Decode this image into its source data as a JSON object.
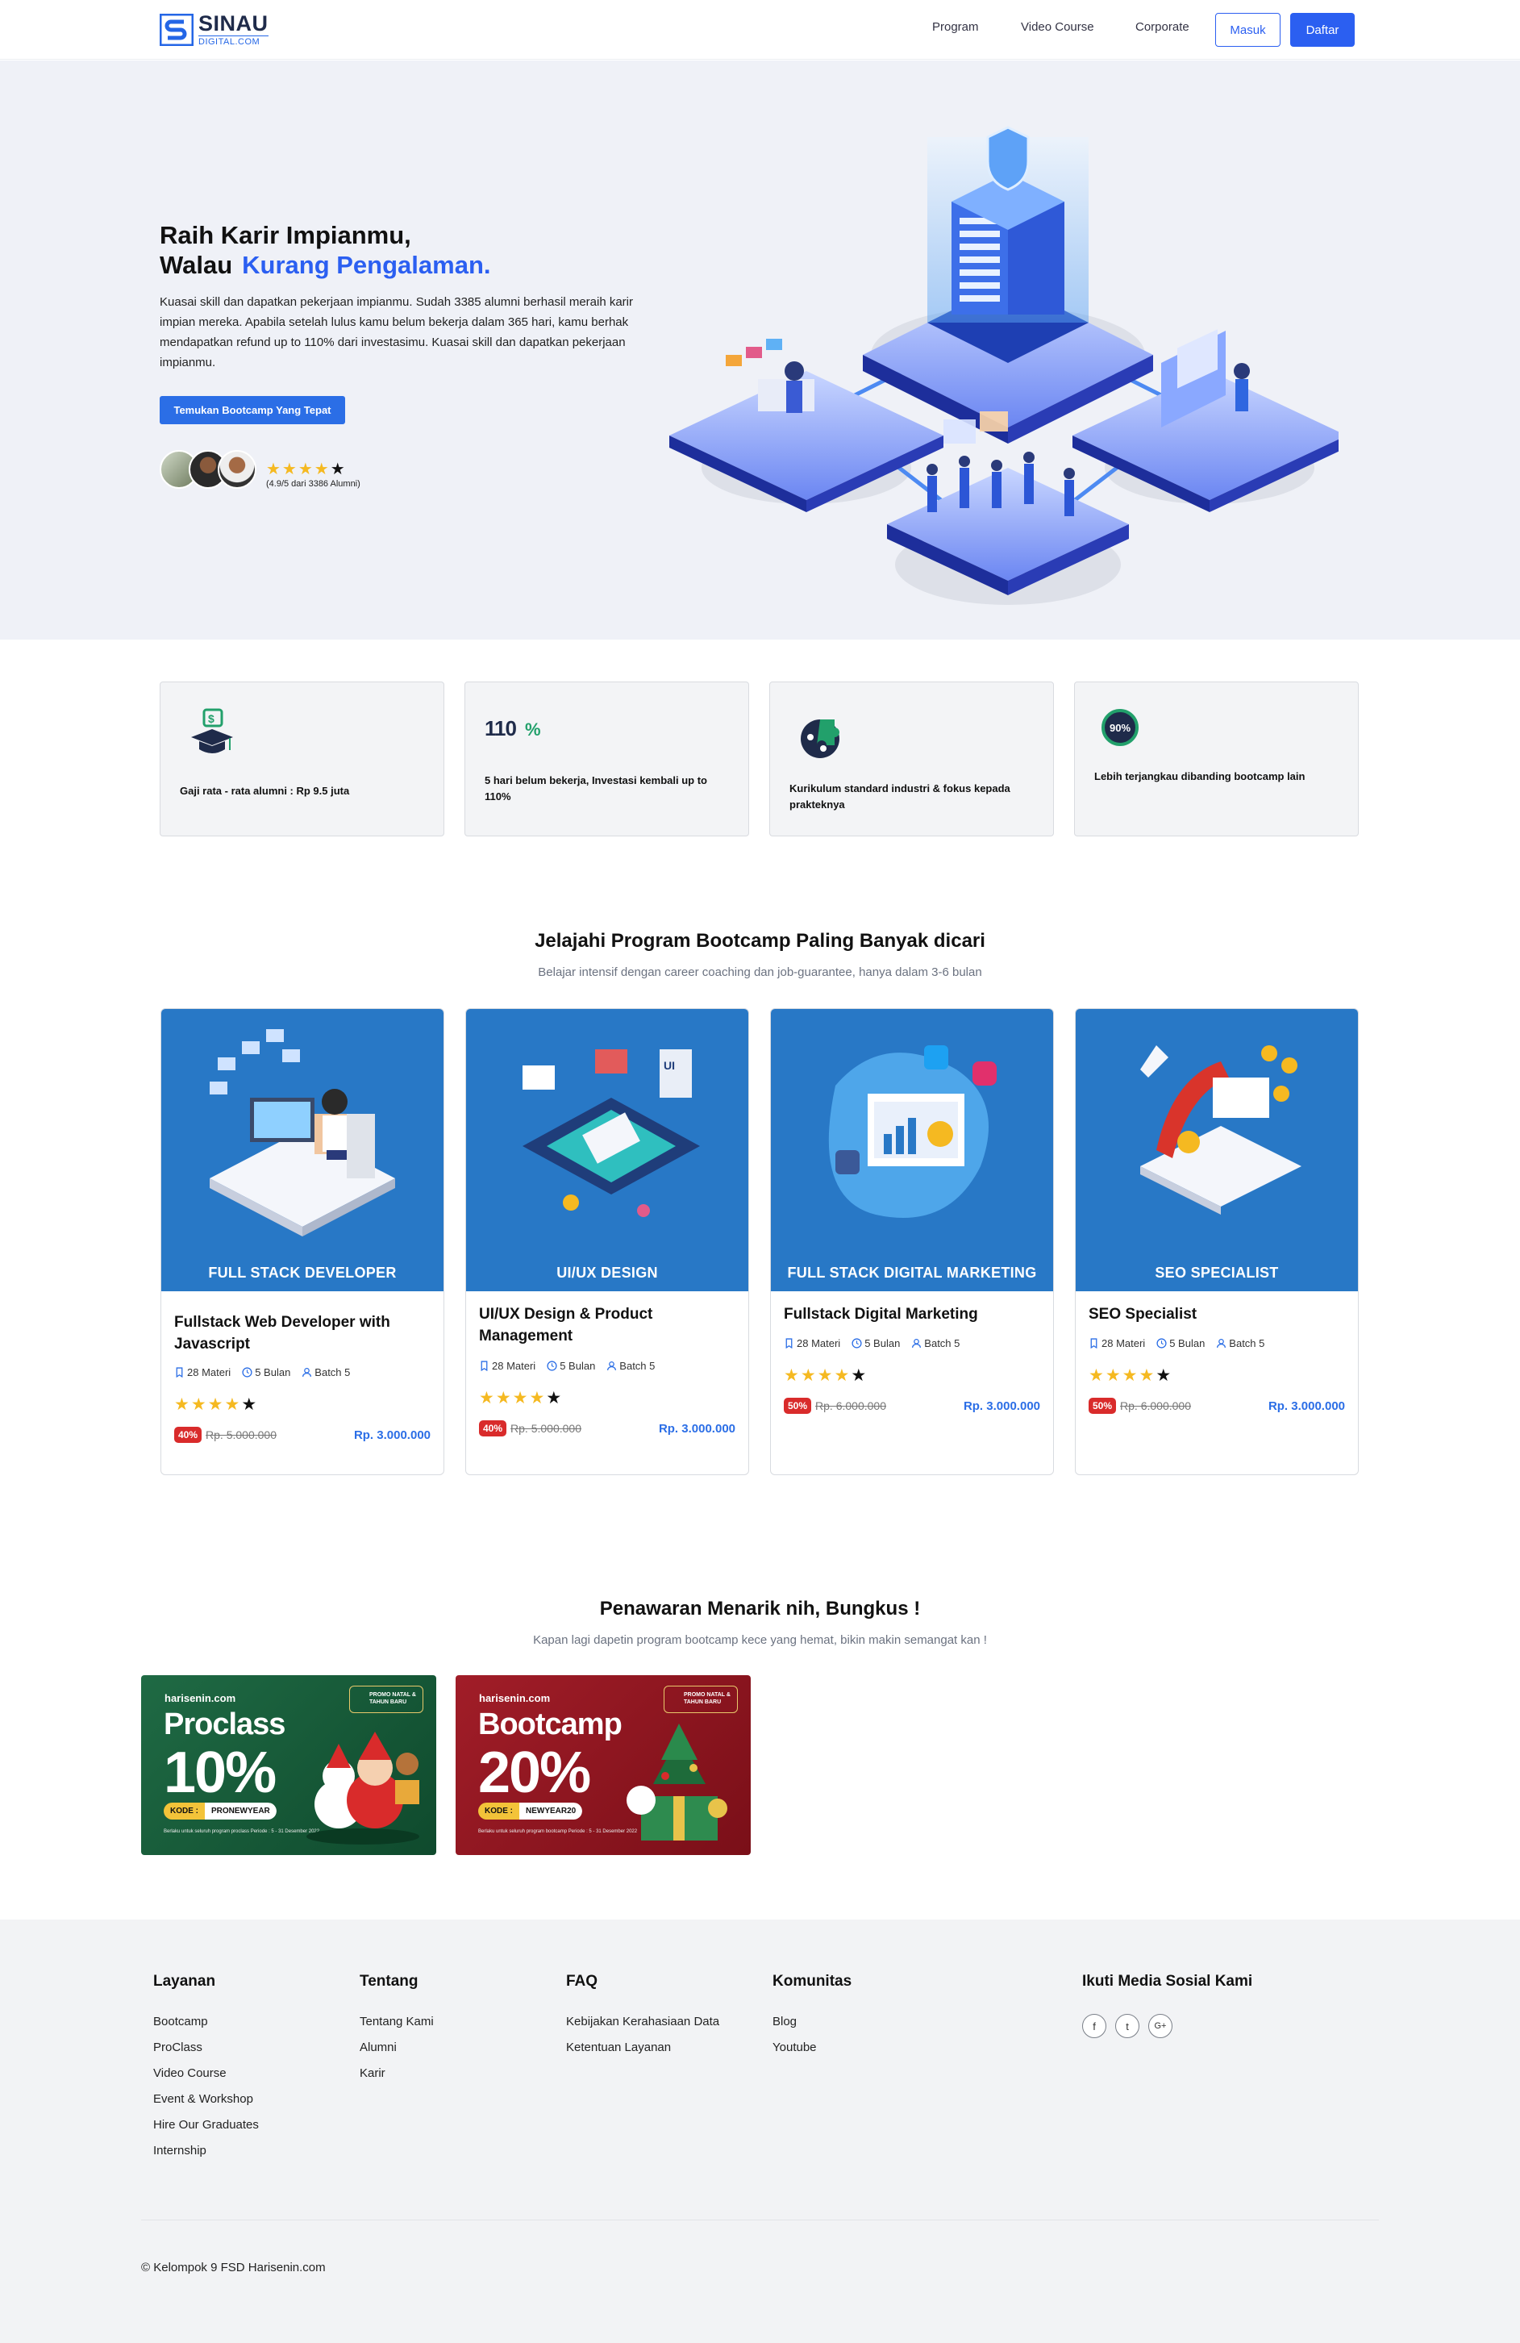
{
  "nav": {
    "logo_line1": "SINAU",
    "logo_line2": "DIGITAL.COM",
    "links": [
      "Program",
      "Video Course",
      "Corporate"
    ],
    "login": "Masuk",
    "register": "Daftar"
  },
  "hero": {
    "title_line1": "Raih Karir Impianmu,",
    "title_line2_prefix": "Walau",
    "title_line2_accent": "Kurang Pengalaman.",
    "paragraph": "Kuasai skill dan dapatkan pekerjaan impianmu. Sudah 3385 alumni berhasil meraih karir impian mereka. Apabila setelah lulus kamu belum bekerja dalam 365 hari, kamu berhak mendapatkan refund up to 110% dari investasimu. Kuasai skill dan dapatkan pekerjaan impianmu.",
    "cta": "Temukan Bootcamp Yang Tepat",
    "rating_text": "(4.9/5 dari 3386 Alumni)",
    "rating_stars_filled": 4,
    "rating_stars_total": 5
  },
  "features": [
    {
      "icon": "salary-graduation-icon",
      "text": "Gaji rata - rata alumni : Rp 9.5 juta"
    },
    {
      "icon": "110-percent-icon",
      "badge": "110%",
      "text": "5 hari belum bekerja, Investasi kembali up to 110%"
    },
    {
      "icon": "puzzle-icon",
      "text": "Kurikulum standard industri & fokus kepada prakteknya"
    },
    {
      "icon": "90-percent-icon",
      "badge": "90%",
      "text": "Lebih terjangkau dibanding bootcamp lain"
    }
  ],
  "programs": {
    "title": "Jelajahi Program Bootcamp Paling Banyak dicari",
    "subtitle": "Belajar intensif dengan career coaching dan job-guarantee, hanya dalam 3-6 bulan",
    "cards": [
      {
        "image_label": "FULL STACK DEVELOPER",
        "title": "Fullstack Web Developer with Javascript",
        "materi": "28 Materi",
        "duration": "5 Bulan",
        "batch": "Batch 5",
        "stars": 4,
        "discount": "40%",
        "old_price": "Rp. 5.000.000",
        "price": "Rp. 3.000.000"
      },
      {
        "image_label": "UI/UX DESIGN",
        "title": "UI/UX Design & Product Management",
        "materi": "28 Materi",
        "duration": "5 Bulan",
        "batch": "Batch 5",
        "stars": 4,
        "discount": "40%",
        "old_price": "Rp. 5.000.000",
        "price": "Rp. 3.000.000"
      },
      {
        "image_label": "FULL STACK DIGITAL MARKETING",
        "title": "Fullstack Digital Marketing",
        "materi": "28 Materi",
        "duration": "5 Bulan",
        "batch": "Batch 5",
        "stars": 4,
        "discount": "50%",
        "old_price": "Rp. 6.000.000",
        "price": "Rp. 3.000.000"
      },
      {
        "image_label": "SEO SPECIALIST",
        "title": "SEO Specialist",
        "materi": "28 Materi",
        "duration": "5 Bulan",
        "batch": "Batch 5",
        "stars": 4,
        "discount": "50%",
        "old_price": "Rp. 6.000.000",
        "price": "Rp. 3.000.000"
      }
    ]
  },
  "offers": {
    "title": "Penawaran Menarik nih, Bungkus !",
    "subtitle": "Kapan lagi dapetin program bootcamp kece yang hemat, bikin makin semangat kan !",
    "banners": [
      {
        "brand": "harisenin.com",
        "badge": "PROMO NATAL & TAHUN BARU",
        "name": "Proclass",
        "percent": "10%",
        "code_label": "KODE :",
        "code": "PRONEWYEAR",
        "note": "Berlaku untuk seluruh program proclass Periode : 5 - 31 Desember 2022",
        "color": "#1d5a3a"
      },
      {
        "brand": "harisenin.com",
        "badge": "PROMO NATAL & TAHUN BARU",
        "name": "Bootcamp",
        "percent": "20%",
        "code_label": "KODE :",
        "code": "NEWYEAR20",
        "note": "Berlaku untuk seluruh program bootcamp Periode : 5 - 31 Desember 2022",
        "color": "#8e1a22"
      }
    ]
  },
  "footer": {
    "columns": [
      {
        "title": "Layanan",
        "links": [
          "Bootcamp",
          "ProClass",
          "Video Course",
          "Event & Workshop",
          "Hire Our Graduates",
          "Internship"
        ]
      },
      {
        "title": "Tentang",
        "links": [
          "Tentang Kami",
          "Alumni",
          "Karir"
        ]
      },
      {
        "title": "FAQ",
        "links": [
          "Kebijakan Kerahasiaan Data",
          "Ketentuan Layanan"
        ]
      },
      {
        "title": "Komunitas",
        "links": [
          "Blog",
          "Youtube"
        ]
      },
      {
        "title": "Ikuti Media Sosial Kami",
        "links": []
      }
    ],
    "social": [
      {
        "icon": "facebook-icon",
        "glyph": "f"
      },
      {
        "icon": "twitter-icon",
        "glyph": "t"
      },
      {
        "icon": "google-plus-icon",
        "glyph": "G+"
      }
    ],
    "copyright": "© Kelompok 9 FSD Harisenin.com"
  },
  "colors": {
    "primary": "#2b5ff1",
    "accent_blue": "#2b6ee6",
    "star": "#f5b921",
    "discount": "#d92b2b",
    "card_image_bg": "#2878c6"
  }
}
